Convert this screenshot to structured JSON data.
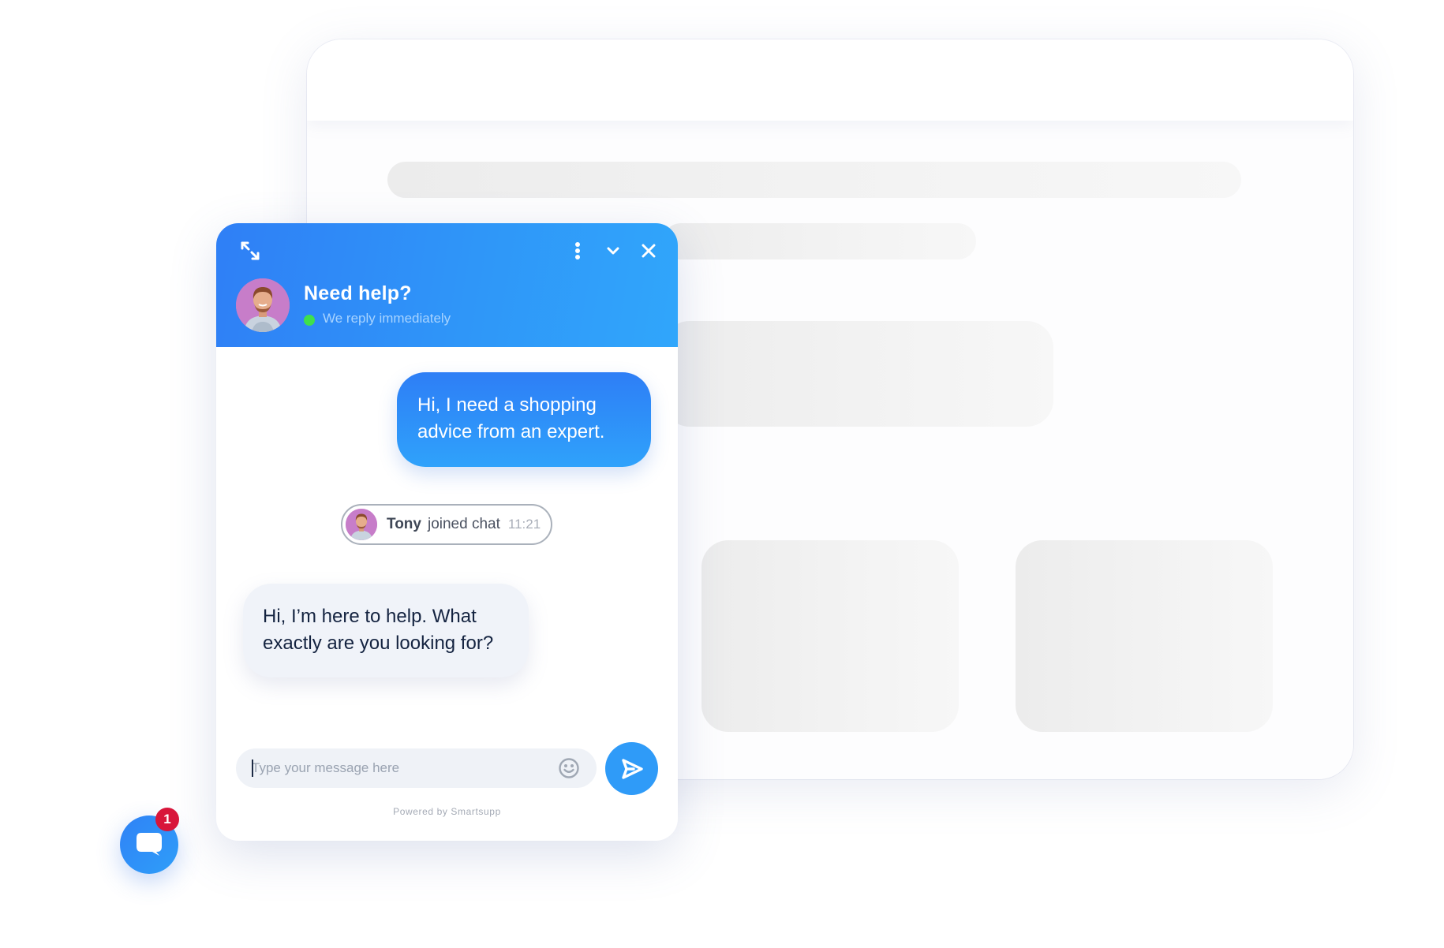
{
  "browser": {
    "window_controls": [
      {
        "name": "close",
        "color": "#ff6b67"
      },
      {
        "name": "minimize",
        "color": "#ffb950"
      },
      {
        "name": "maximize",
        "color": "#52c965"
      }
    ]
  },
  "chat": {
    "header": {
      "title": "Need help?",
      "status": "We reply immediately",
      "status_color": "#3fe04c",
      "icons": [
        "expand-icon",
        "more-vertical-icon",
        "chevron-down-icon",
        "close-icon"
      ]
    },
    "messages": [
      {
        "from": "visitor",
        "text": "Hi, I need a shopping advice from an expert."
      },
      {
        "type": "event",
        "name": "Tony",
        "text": "joined chat",
        "time": "11:21"
      },
      {
        "from": "agent",
        "text": "Hi, I’m here to help. What exactly are you looking for?"
      }
    ],
    "input": {
      "placeholder": "Type your message here",
      "value": ""
    },
    "send_icon": "send-icon",
    "emoji_icon": "smiley-icon",
    "footer": "Powered by Smartsupp",
    "accent_color": "#2f8ff7"
  },
  "launcher": {
    "icon": "chat-bubble-icon",
    "badge_count": "1",
    "badge_color": "#d8153a"
  }
}
